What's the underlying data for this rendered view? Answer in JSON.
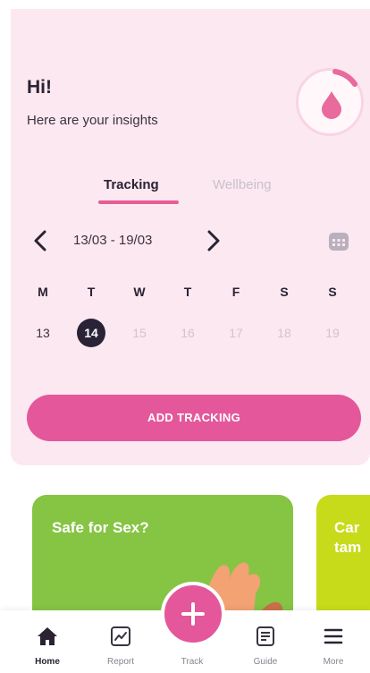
{
  "header": {
    "greeting": "Hi!",
    "subtitle": "Here are your insights"
  },
  "tabs": [
    {
      "label": "Tracking",
      "active": true
    },
    {
      "label": "Wellbeing",
      "active": false
    }
  ],
  "week": {
    "range": "13/03 - 19/03",
    "day_labels": [
      "M",
      "T",
      "W",
      "T",
      "F",
      "S",
      "S"
    ],
    "dates": [
      "13",
      "14",
      "15",
      "16",
      "17",
      "18",
      "19"
    ],
    "today": "14"
  },
  "add_tracking_label": "ADD TRACKING",
  "promos": [
    {
      "title": "Safe for Sex?"
    },
    {
      "title": "Car tam"
    }
  ],
  "nav": {
    "items": [
      {
        "label": "Home",
        "icon": "home-icon"
      },
      {
        "label": "Report",
        "icon": "chart-icon"
      },
      {
        "label": "Track",
        "icon": "plus-icon"
      },
      {
        "label": "Guide",
        "icon": "document-icon"
      },
      {
        "label": "More",
        "icon": "menu-icon"
      }
    ]
  },
  "colors": {
    "accent": "#e4579a",
    "background_card": "#fce8f0",
    "today_circle": "#2a2236",
    "promo_green": "#86c444",
    "promo_lime": "#c7db1a"
  }
}
